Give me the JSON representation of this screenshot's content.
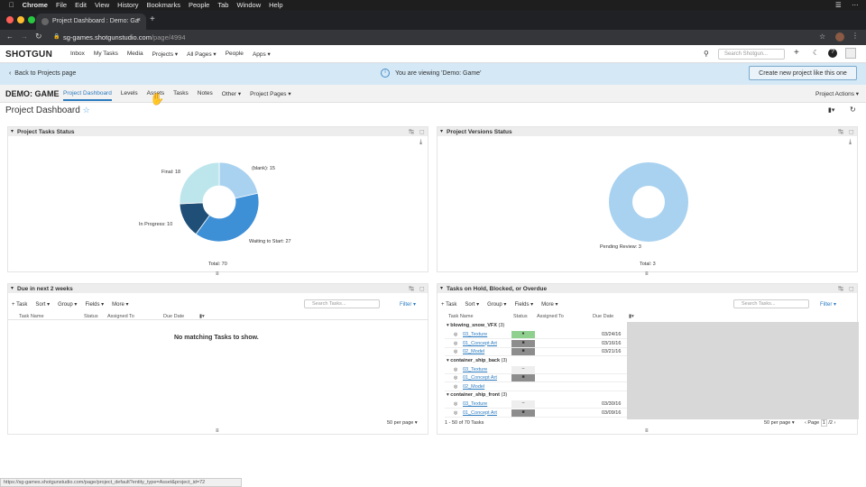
{
  "mac_menu": [
    "Chrome",
    "File",
    "Edit",
    "View",
    "History",
    "Bookmarks",
    "People",
    "Tab",
    "Window",
    "Help"
  ],
  "browser": {
    "tab_title": "Project Dashboard : Demo: Ga",
    "url_host": "sg-games.shotgunstudio.com",
    "url_path": "/page/4994"
  },
  "header": {
    "logo": "SHOTGUN",
    "nav": [
      "Inbox",
      "My Tasks",
      "Media",
      "Projects ▾",
      "All Pages ▾",
      "People",
      "Apps ▾"
    ],
    "search_placeholder": "Search Shotgun..."
  },
  "banner": {
    "back": "Back to Projects page",
    "message": "You are viewing 'Demo: Game'",
    "create_button": "Create new project like this one"
  },
  "project": {
    "name": "DEMO: GAME",
    "tabs": [
      "Project Dashboard",
      "Levels",
      "Assets",
      "Tasks",
      "Notes",
      "Other ▾",
      "Project Pages ▾"
    ],
    "actions": "Project Actions ▾",
    "page_title": "Project Dashboard"
  },
  "panels": {
    "tasks_status": {
      "title": "Project Tasks Status",
      "total": "Total: 70",
      "labels": [
        "Final: 18",
        "(blank): 15",
        "In Progress: 10",
        "Waiting to Start: 27"
      ]
    },
    "versions_status": {
      "title": "Project Versions Status",
      "total": "Total: 3",
      "labels": [
        "Pending Review: 3"
      ]
    },
    "due": {
      "title": "Due in next 2 weeks",
      "toolbar": [
        "+ Task",
        "Sort ▾",
        "Group ▾",
        "Fields ▾",
        "More ▾"
      ],
      "search_placeholder": "Search Tasks...",
      "filter": "Filter ▾",
      "columns": [
        "Task Name",
        "Status",
        "Assigned To",
        "Due Date"
      ],
      "empty": "No matching Tasks to show.",
      "per_page": "50 per page ▾"
    },
    "hold": {
      "title": "Tasks on Hold, Blocked, or Overdue",
      "toolbar": [
        "+ Task",
        "Sort ▾",
        "Group ▾",
        "Fields ▾",
        "More ▾"
      ],
      "search_placeholder": "Search Tasks...",
      "filter": "Filter ▾",
      "columns": [
        "Task Name",
        "Status",
        "Assigned To",
        "Due Date"
      ],
      "groups": [
        {
          "name": "blowing_snow_VFX",
          "count": "(3)",
          "rows": [
            {
              "task": "03_Texture",
              "status": "hold",
              "due": "03/24/16"
            },
            {
              "task": "01_Concept Art",
              "status": "blocked",
              "due": "03/16/16"
            },
            {
              "task": "02_Model",
              "status": "blocked",
              "due": "03/21/16"
            }
          ]
        },
        {
          "name": "container_ship_back",
          "count": "(3)",
          "rows": [
            {
              "task": "03_Texture",
              "status": "pending",
              "due": ""
            },
            {
              "task": "01_Concept Art",
              "status": "blocked",
              "due": ""
            },
            {
              "task": "02_Model",
              "status": "",
              "due": ""
            }
          ]
        },
        {
          "name": "container_ship_front",
          "count": "(3)",
          "rows": [
            {
              "task": "03_Texture",
              "status": "pending",
              "due": "03/30/16"
            },
            {
              "task": "01_Concept Art",
              "status": "blocked",
              "due": "03/09/16"
            }
          ]
        }
      ],
      "range": "1 - 50 of 70 Tasks",
      "per_page": "50 per page ▾",
      "page_prefix": "‹ Page",
      "page_num": "1",
      "page_total": "/2 ›"
    }
  },
  "chart_data": [
    {
      "type": "pie",
      "title": "Project Tasks Status",
      "categories": [
        "(blank)",
        "Waiting to Start",
        "In Progress",
        "Final"
      ],
      "values": [
        15,
        27,
        10,
        18
      ],
      "colors": [
        "#a9d2f0",
        "#3d8fd6",
        "#1f4f77",
        "#bde6ec"
      ]
    },
    {
      "type": "pie",
      "title": "Project Versions Status",
      "categories": [
        "Pending Review"
      ],
      "values": [
        3
      ],
      "colors": [
        "#a9d2f0"
      ]
    }
  ],
  "status_bar_url": "https://sg-games.shotgunstudio.com/page/project_default?entity_type=Asset&project_id=72"
}
